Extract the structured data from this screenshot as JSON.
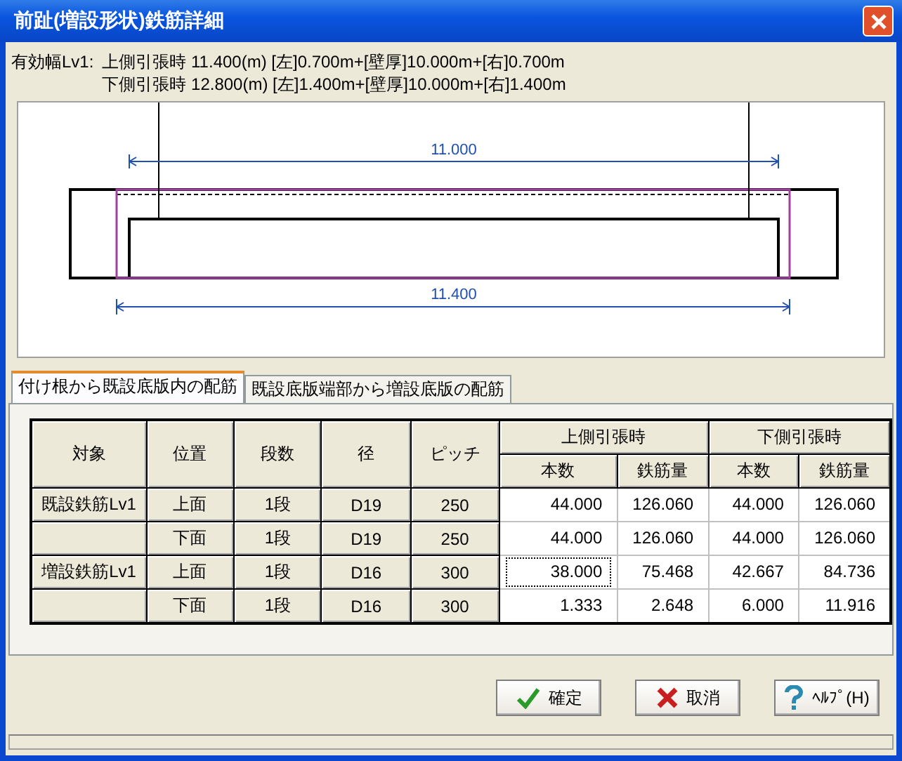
{
  "window": {
    "title": "前趾(増設形状)鉄筋詳細"
  },
  "effective_width": {
    "label": "有効幅Lv1:",
    "lines": [
      "上側引張時 11.400(m) [左]0.700m+[壁厚]10.000m+[右]0.700m",
      "下側引張時 12.800(m) [左]1.400m+[壁厚]10.000m+[右]1.400m"
    ]
  },
  "drawing": {
    "top_dimension": "11.000",
    "bottom_dimension": "11.400"
  },
  "tabs": [
    {
      "label": "付け根から既設底版内の配筋",
      "selected": true
    },
    {
      "label": "既設底版端部から増設底版の配筋",
      "selected": false
    }
  ],
  "table": {
    "columns": [
      "対象",
      "位置",
      "段数",
      "径",
      "ピッチ"
    ],
    "groups": [
      {
        "label": "上側引張時",
        "columns": [
          "本数",
          "鉄筋量"
        ]
      },
      {
        "label": "下側引張時",
        "columns": [
          "本数",
          "鉄筋量"
        ]
      }
    ],
    "rows": [
      {
        "target": "既設鉄筋Lv1",
        "position": "上面",
        "tiers": "1段",
        "diameter": "D19",
        "pitch": "250",
        "values": [
          {
            "text": "44.000",
            "focused": false
          },
          {
            "text": "126.060",
            "focused": false
          },
          {
            "text": "44.000",
            "focused": false
          },
          {
            "text": "126.060",
            "focused": false
          }
        ]
      },
      {
        "position": "下面",
        "tiers": "1段",
        "diameter": "D19",
        "pitch": "250",
        "values": [
          {
            "text": "44.000",
            "focused": false
          },
          {
            "text": "126.060",
            "focused": false
          },
          {
            "text": "44.000",
            "focused": false
          },
          {
            "text": "126.060",
            "focused": false
          }
        ]
      },
      {
        "target": "増設鉄筋Lv1",
        "position": "上面",
        "tiers": "1段",
        "diameter": "D16",
        "pitch": "300",
        "values": [
          {
            "text": "38.000",
            "focused": true
          },
          {
            "text": "75.468",
            "focused": false
          },
          {
            "text": "42.667",
            "focused": false
          },
          {
            "text": "84.736",
            "focused": false
          }
        ]
      },
      {
        "position": "下面",
        "tiers": "1段",
        "diameter": "D16",
        "pitch": "300",
        "values": [
          {
            "text": "1.333",
            "focused": false
          },
          {
            "text": "2.648",
            "focused": false
          },
          {
            "text": "6.000",
            "focused": false
          },
          {
            "text": "11.916",
            "focused": false
          }
        ]
      }
    ]
  },
  "buttons": [
    {
      "kind": "ok",
      "label": "確定"
    },
    {
      "kind": "cancel",
      "label": "取消"
    },
    {
      "kind": "help",
      "label": "ﾍﾙﾌﾟ(H)"
    }
  ]
}
